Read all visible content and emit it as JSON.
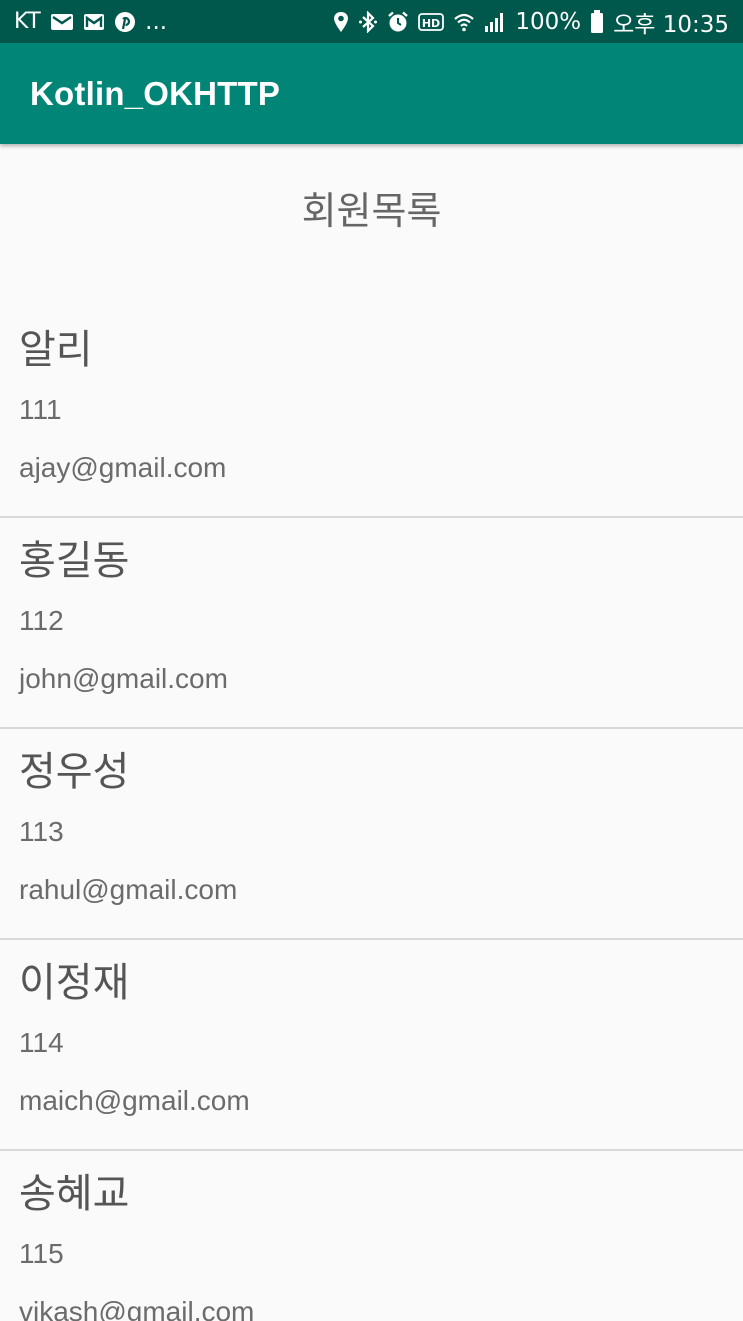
{
  "status_bar": {
    "carrier": "KT",
    "more": "...",
    "battery": "100%",
    "time": "오후 10:35",
    "icons_left": [
      "mail-icon",
      "gmail-icon",
      "pinterest-icon"
    ],
    "icons_right": [
      "location-icon",
      "bluetooth-icon",
      "alarm-icon",
      "hd-icon",
      "wifi-icon",
      "signal-icon",
      "battery-icon"
    ]
  },
  "app_bar": {
    "title": "Kotlin_OKHTTP"
  },
  "heading": "회원목록",
  "members": [
    {
      "name": "알리",
      "id": "111",
      "email": "ajay@gmail.com"
    },
    {
      "name": "홍길동",
      "id": "112",
      "email": "john@gmail.com"
    },
    {
      "name": "정우성",
      "id": "113",
      "email": "rahul@gmail.com"
    },
    {
      "name": "이정재",
      "id": "114",
      "email": "maich@gmail.com"
    },
    {
      "name": "송혜교",
      "id": "115",
      "email": "vikash@gmail.com"
    }
  ]
}
